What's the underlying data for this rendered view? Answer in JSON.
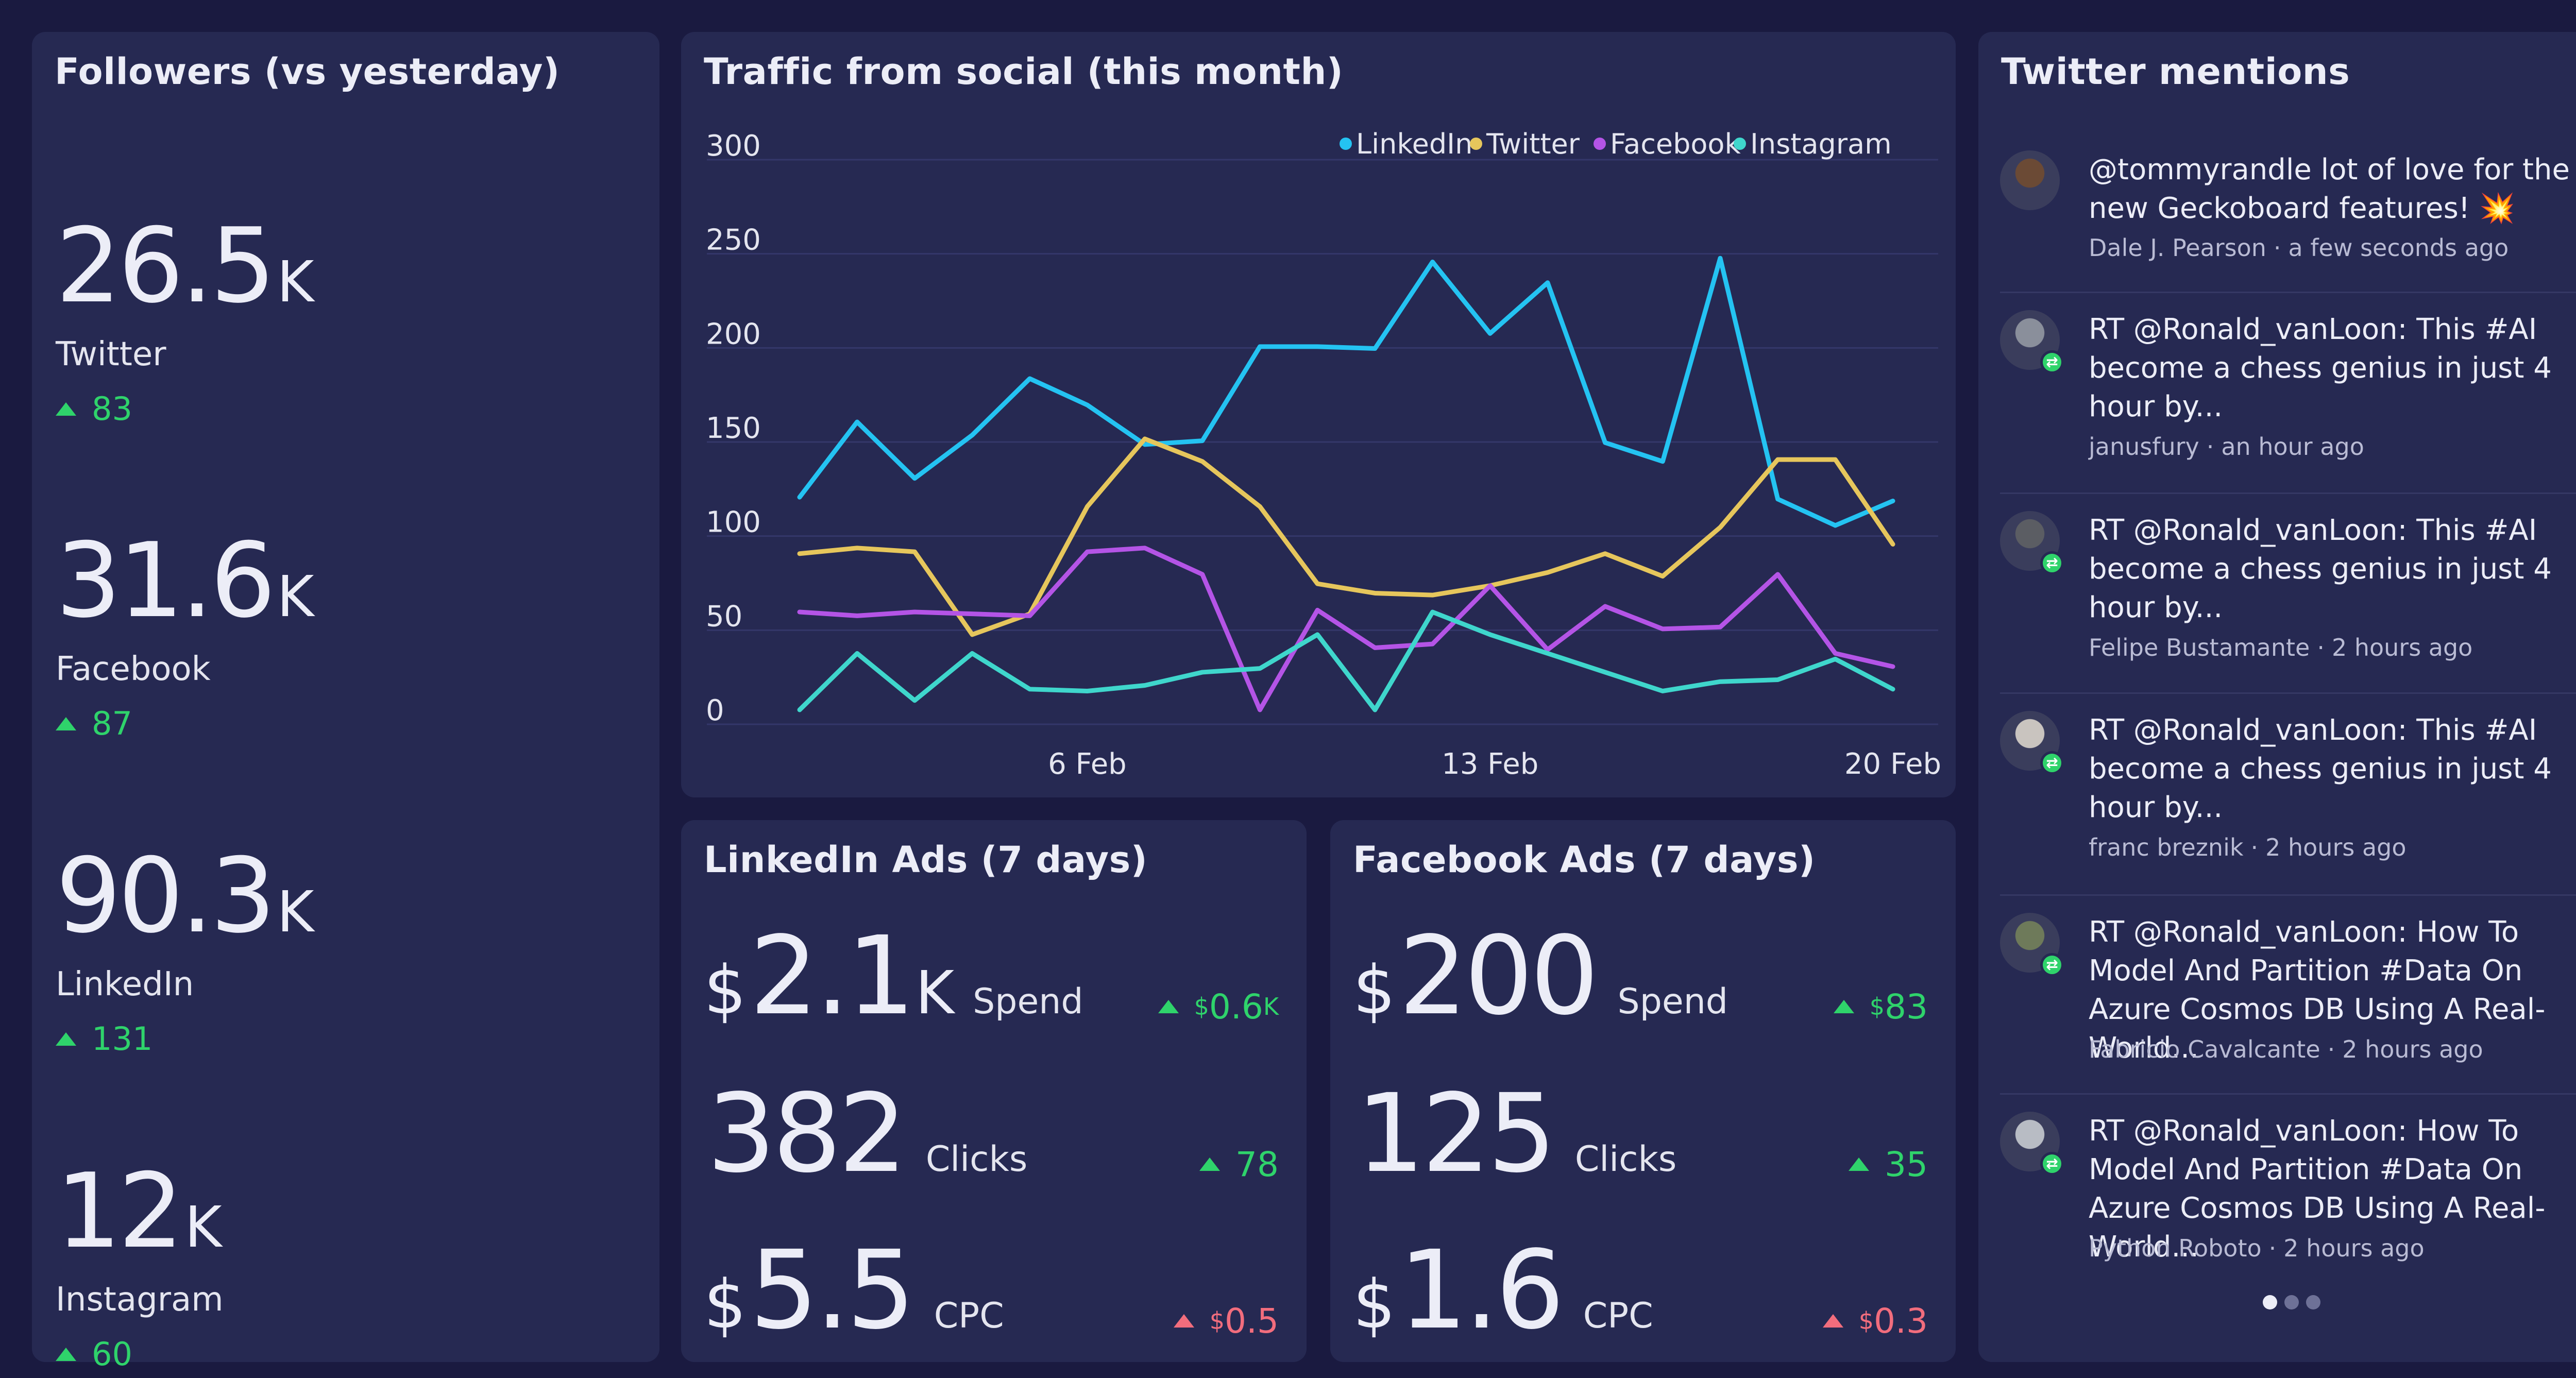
{
  "colors": {
    "background": "#1a1a40",
    "panel": "#262952",
    "positive": "#2fd36b",
    "negative": "#f26d7d",
    "linkedin": "#24c3f2",
    "twitter": "#e6c65c",
    "facebook": "#b454e6",
    "instagram": "#3fd6cc"
  },
  "followers": {
    "title": "Followers (vs yesterday)",
    "items": [
      {
        "value": "26.5",
        "unit": "K",
        "label": "Twitter",
        "delta": "83"
      },
      {
        "value": "31.6",
        "unit": "K",
        "label": "Facebook",
        "delta": "87"
      },
      {
        "value": "90.3",
        "unit": "K",
        "label": "LinkedIn",
        "delta": "131"
      },
      {
        "value": "12",
        "unit": "K",
        "label": "Instagram",
        "delta": "60"
      }
    ]
  },
  "traffic": {
    "title": "Traffic from social (this month)"
  },
  "chart_data": {
    "type": "line",
    "title": "Traffic from social (this month)",
    "x": [
      1,
      2,
      3,
      4,
      5,
      6,
      7,
      8,
      9,
      10,
      11,
      12,
      13,
      14,
      15,
      16,
      17,
      18,
      19,
      20
    ],
    "xticks": [
      {
        "x": 6,
        "label": "6 Feb"
      },
      {
        "x": 13,
        "label": "13 Feb"
      },
      {
        "x": 20,
        "label": "20 Feb"
      }
    ],
    "ylim": [
      0,
      300
    ],
    "yticks": [
      0,
      50,
      100,
      150,
      200,
      250,
      300
    ],
    "grid": true,
    "legend": "top-right",
    "series": [
      {
        "name": "LinkedIn",
        "color": "#24c3f2",
        "values": [
          113,
          153,
          123,
          146,
          176,
          162,
          141,
          143,
          193,
          193,
          192,
          238,
          200,
          227,
          142,
          132,
          240,
          112,
          98,
          111
        ]
      },
      {
        "name": "Twitter",
        "color": "#e6c65c",
        "values": [
          83,
          86,
          84,
          40,
          51,
          108,
          144,
          132,
          108,
          67,
          62,
          61,
          66,
          73,
          83,
          71,
          97,
          133,
          133,
          88
        ]
      },
      {
        "name": "Facebook",
        "color": "#b454e6",
        "values": [
          52,
          50,
          52,
          51,
          50,
          84,
          86,
          72,
          0,
          53,
          33,
          35,
          66,
          32,
          55,
          43,
          44,
          72,
          30,
          23
        ]
      },
      {
        "name": "Instagram",
        "color": "#3fd6cc",
        "values": [
          0,
          30,
          5,
          30,
          11,
          10,
          13,
          20,
          22,
          40,
          0,
          52,
          40,
          30,
          20,
          10,
          15,
          16,
          27,
          11
        ]
      }
    ]
  },
  "linkedin_ads": {
    "title": "LinkedIn Ads (7 days)",
    "rows": [
      {
        "currency": "$",
        "value": "2.1",
        "unit": "K",
        "metric": "Spend",
        "delta_currency": "$",
        "delta": "0.6",
        "delta_unit": "K",
        "direction": "up"
      },
      {
        "currency": "",
        "value": "382",
        "unit": "",
        "metric": "Clicks",
        "delta_currency": "",
        "delta": "78",
        "delta_unit": "",
        "direction": "up"
      },
      {
        "currency": "$",
        "value": "5.5",
        "unit": "",
        "metric": "CPC",
        "delta_currency": "$",
        "delta": "0.5",
        "delta_unit": "",
        "direction": "up-red"
      }
    ]
  },
  "facebook_ads": {
    "title": "Facebook Ads (7 days)",
    "rows": [
      {
        "currency": "$",
        "value": "200",
        "unit": "",
        "metric": "Spend",
        "delta_currency": "$",
        "delta": "83",
        "delta_unit": "",
        "direction": "up"
      },
      {
        "currency": "",
        "value": "125",
        "unit": "",
        "metric": "Clicks",
        "delta_currency": "",
        "delta": "35",
        "delta_unit": "",
        "direction": "up"
      },
      {
        "currency": "$",
        "value": "1.6",
        "unit": "",
        "metric": "CPC",
        "delta_currency": "$",
        "delta": "0.3",
        "delta_unit": "",
        "direction": "up-red"
      }
    ]
  },
  "mentions": {
    "title": "Twitter mentions",
    "items": [
      {
        "text": "@tommyrandle lot of love for the new Geckoboard features! 💥",
        "author": "Dale J. Pearson",
        "time": "a few seconds ago",
        "retweet": false,
        "avatar_color": "#6b4a35"
      },
      {
        "text": "RT @Ronald_vanLoon: This #AI become a chess genius in just 4 hour by...",
        "author": "janusfury",
        "time": "an hour ago",
        "retweet": true,
        "avatar_color": "#8a8f9b"
      },
      {
        "text": "RT @Ronald_vanLoon: This #AI become a chess genius in just 4 hour by...",
        "author": "Felipe Bustamante",
        "time": "2 hours ago",
        "retweet": true,
        "avatar_color": "#5b5d63"
      },
      {
        "text": "RT @Ronald_vanLoon: This #AI become a chess genius in just 4 hour by...",
        "author": "franc breznik",
        "time": "2 hours ago",
        "retweet": true,
        "avatar_color": "#c9c4bf"
      },
      {
        "text": "RT @Ronald_vanLoon: How To Model And Partition #Data On Azure Cosmos DB Using A Real-World...",
        "author": "Fabricio Cavalcante",
        "time": "2 hours ago",
        "retweet": true,
        "avatar_color": "#6e7a5a"
      },
      {
        "text": "RT @Ronald_vanLoon: How To Model And Partition #Data On Azure Cosmos DB Using A Real-World...",
        "author": "Python Roboto",
        "time": "2 hours ago",
        "retweet": true,
        "avatar_color": "#b8bcc4"
      }
    ],
    "separator": "·",
    "pages": 3,
    "active_page": 1
  }
}
